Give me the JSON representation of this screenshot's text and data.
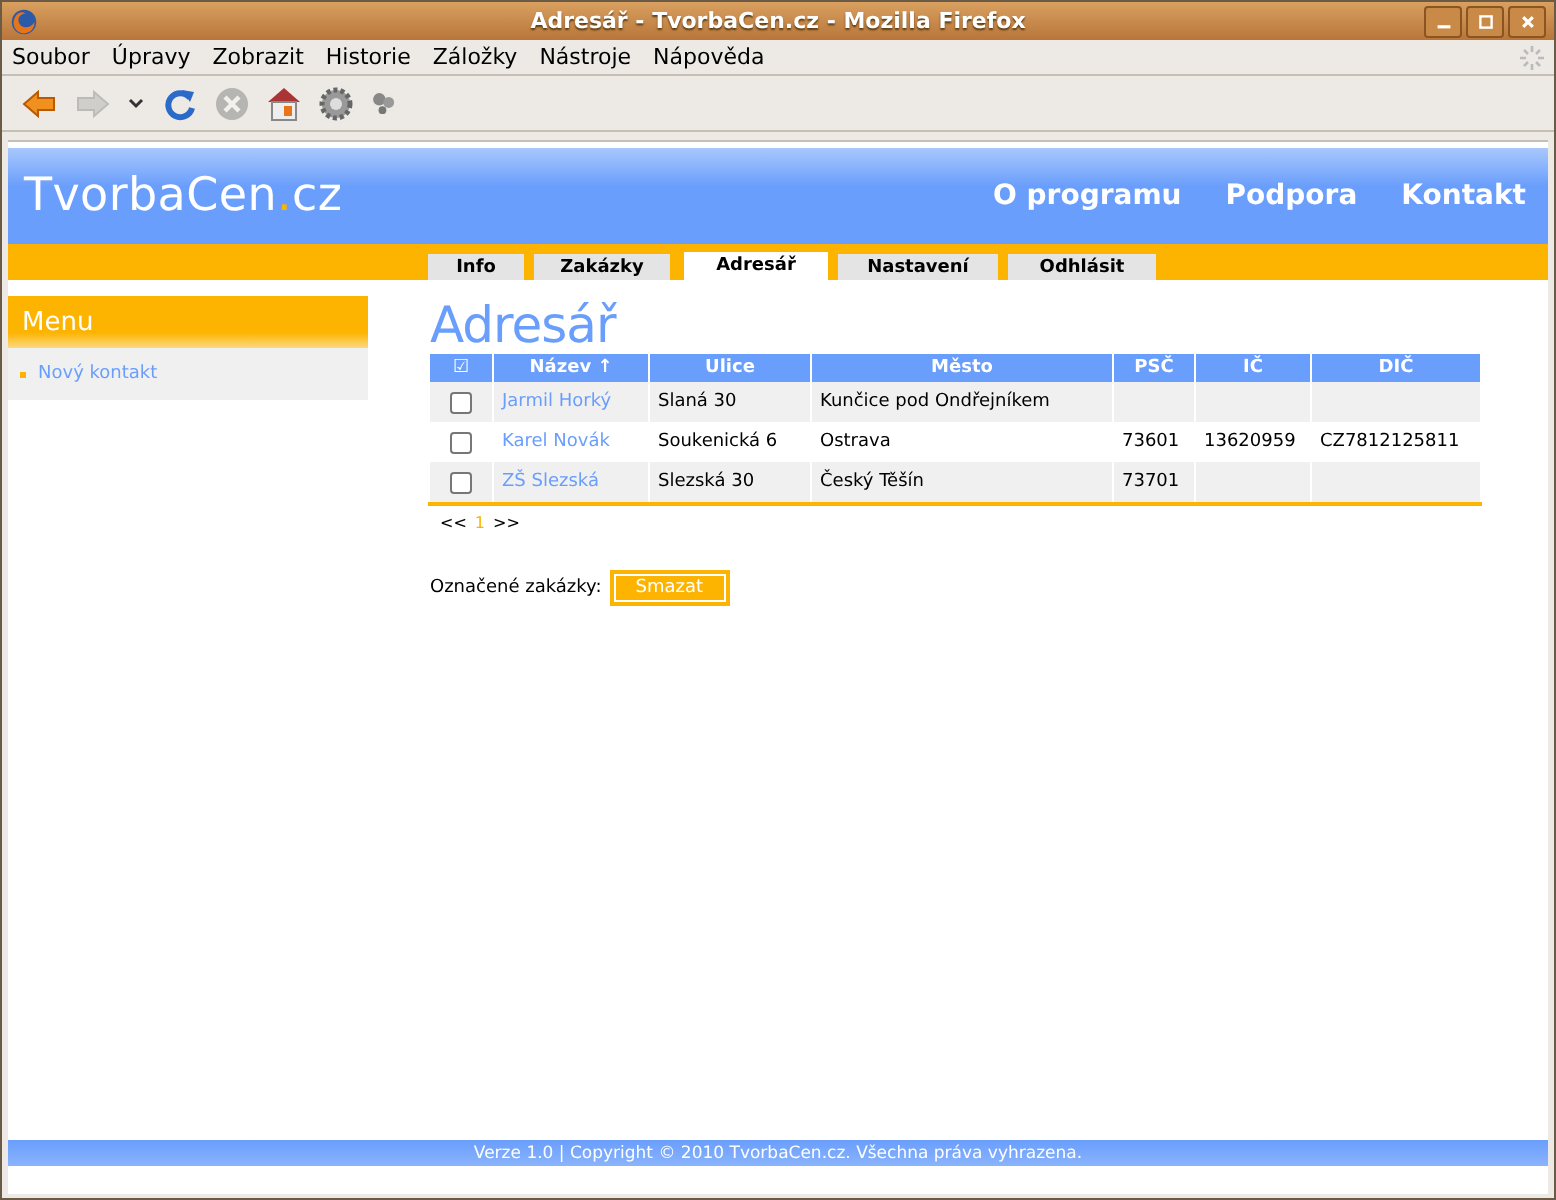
{
  "window": {
    "title": "Adresář - TvorbaCen.cz - Mozilla Firefox"
  },
  "menu_bar": [
    "Soubor",
    "Úpravy",
    "Zobrazit",
    "Historie",
    "Záložky",
    "Nástroje",
    "Nápověda"
  ],
  "toolbar": [
    {
      "kind": "back",
      "disabled": false
    },
    {
      "kind": "forward",
      "disabled": true
    },
    {
      "kind": "dropdown",
      "disabled": false
    },
    {
      "kind": "reload",
      "disabled": false
    },
    {
      "kind": "stop",
      "disabled": true
    },
    {
      "kind": "home",
      "disabled": false
    },
    {
      "kind": "gear",
      "disabled": false
    },
    {
      "kind": "addon",
      "disabled": false
    }
  ],
  "site": {
    "logo": {
      "name": "TvorbaCen",
      "dot": ".",
      "tld": "cz"
    },
    "top_links": [
      "O programu",
      "Podpora",
      "Kontakt"
    ],
    "tabs": [
      {
        "label": "Info",
        "selected": false
      },
      {
        "label": "Zakázky",
        "selected": false
      },
      {
        "label": "Adresář",
        "selected": true
      },
      {
        "label": "Nastavení",
        "selected": false
      },
      {
        "label": "Odhlásit",
        "selected": false
      }
    ],
    "sidebar": {
      "title": "Menu",
      "items": [
        "Nový kontakt"
      ]
    },
    "heading": "Adresář",
    "table": {
      "select_all": "☑",
      "columns": [
        "Název ↑",
        "Ulice",
        "Město",
        "PSČ",
        "IČ",
        "DIČ"
      ],
      "rows": [
        {
          "checked": false,
          "cells": [
            "Jarmil Horký",
            "Slaná 30",
            "Kunčice pod Ondřejníkem",
            "",
            "",
            ""
          ]
        },
        {
          "checked": false,
          "cells": [
            "Karel Novák",
            "Soukenická 6",
            "Ostrava",
            "73601",
            "13620959",
            "CZ7812125811"
          ]
        },
        {
          "checked": false,
          "cells": [
            "ZŠ Slezská",
            "Slezská 30",
            "Český Těšín",
            "73701",
            "",
            ""
          ]
        }
      ]
    },
    "pager": [
      {
        "label": "<<",
        "selected": false
      },
      {
        "label": "1",
        "selected": true
      },
      {
        "label": ">>",
        "selected": false
      }
    ],
    "bulk": {
      "label": "Označené zakázky:",
      "button": "Smazat"
    },
    "footer": "Verze 1.0 | Copyright © 2010 TvorbaCen.cz. Všechna práva vyhrazena."
  }
}
